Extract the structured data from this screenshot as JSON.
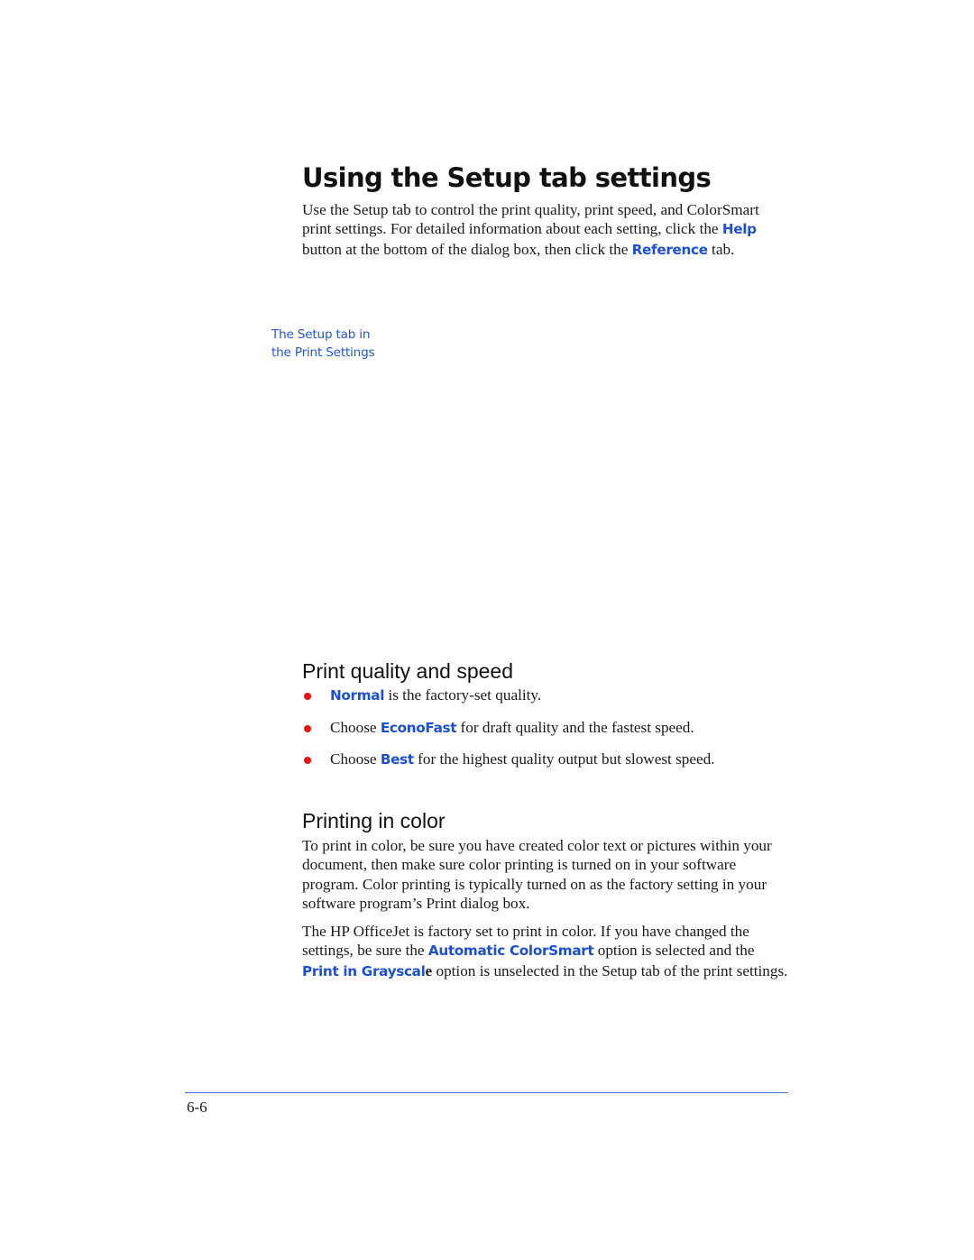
{
  "header": {
    "title": "Using the Setup tab settings"
  },
  "intro": {
    "text_1": "Use the Setup tab to control the print quality, print speed, and ColorSmart print settings. For detailed information about each setting, click the ",
    "help_label": "Help",
    "text_2": " button at the bottom of the dialog box, then click the ",
    "reference_label": "Reference",
    "text_3": " tab."
  },
  "figure_caption": {
    "line_1": "The Setup tab in",
    "line_2": "the Print Settings"
  },
  "print_quality": {
    "heading": "Print quality and speed",
    "items": [
      {
        "prefix": "",
        "keyword": "Normal",
        "suffix": " is the factory-set quality."
      },
      {
        "prefix": "Choose ",
        "keyword": "EconoFast",
        "suffix": " for draft quality and the fastest speed."
      },
      {
        "prefix": "Choose ",
        "keyword": "Best",
        "suffix": " for the highest quality output but slowest speed."
      }
    ]
  },
  "printing_in_color": {
    "heading": "Printing in color",
    "paragraph_1": "To print in color, be sure you have created color text or pictures within your document, then make sure color printing is turned on in your software program. Color printing is typically turned on as the factory setting in your software program’s Print dialog box.",
    "paragraph_2": {
      "text_1": "The HP OfficeJet is factory set to print in color. If you have changed the settings, be sure the ",
      "automatic_colorsmart_label": "Automatic ColorSmart",
      "text_2": " option is selected and the ",
      "grayscale_label": "Print in Grayscal",
      "grayscale_tail": "e",
      "text_3": " option is unselected in the Setup tab of the print settings."
    }
  },
  "footer": {
    "page_number": "6-6"
  },
  "colors": {
    "accent_blue": "#1a4fd6",
    "caption_blue": "#2255dd",
    "bullet_red": "#ee1111",
    "rule_blue": "#3a78d8"
  }
}
